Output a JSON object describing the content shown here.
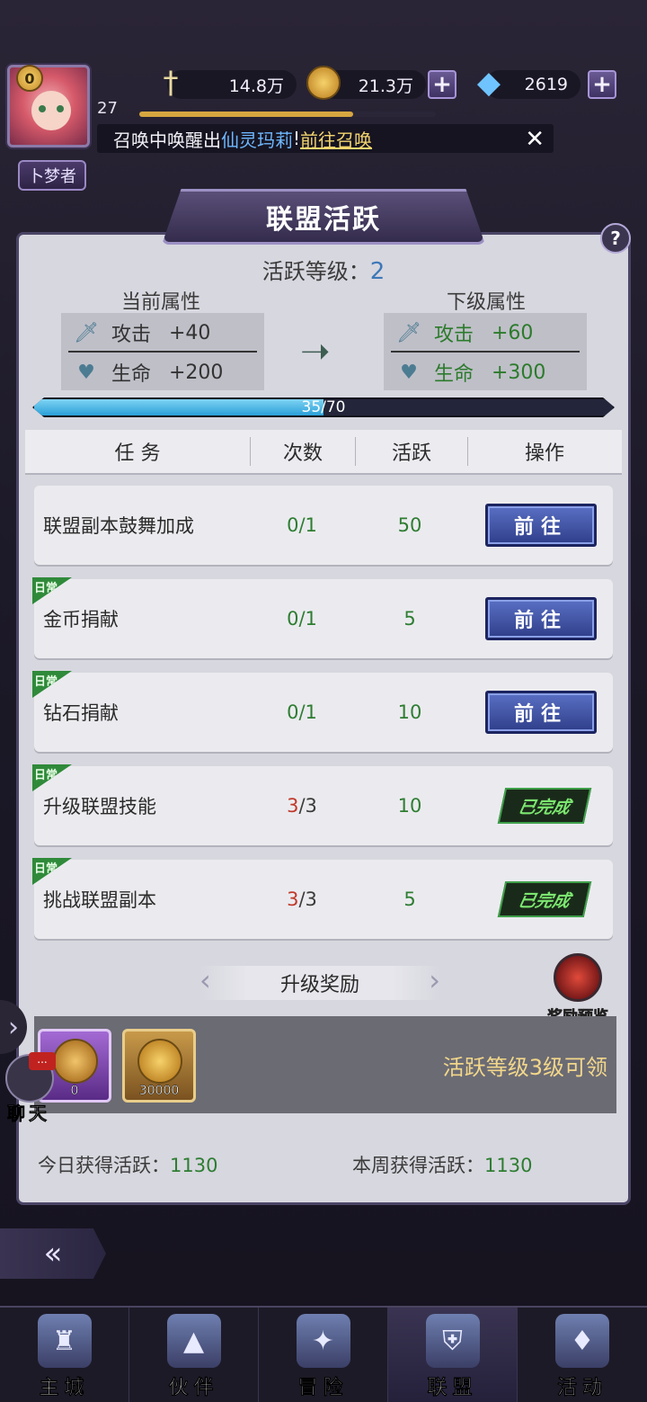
{
  "header": {
    "vip_level": "0",
    "player_level": "27",
    "title_tag": "卜梦者",
    "power": "14.8万",
    "gold": "21.3万",
    "diamonds": "2619",
    "xp_fraction": 0.72,
    "ticker_prefix": "召唤中唤醒出",
    "ticker_hero": "仙灵玛莉",
    "ticker_excl": "!",
    "ticker_link": "前往召唤"
  },
  "panel": {
    "title": "联盟活跃",
    "help": "?",
    "activity_level_label": "活跃等级：",
    "activity_level": "2",
    "current_attr_title": "当前属性",
    "next_attr_title": "下级属性",
    "current": [
      {
        "icon": "sword-icon",
        "label": "攻击",
        "value": "+40"
      },
      {
        "icon": "heart-icon",
        "label": "生命",
        "value": "+200"
      }
    ],
    "next": [
      {
        "icon": "sword-icon",
        "label": "攻击",
        "value": "+60"
      },
      {
        "icon": "heart-icon",
        "label": "生命",
        "value": "+300"
      }
    ],
    "progress_text": "35/70",
    "progress_value": 35,
    "progress_max": 70
  },
  "table": {
    "headers": [
      "任  务",
      "次数",
      "活跃",
      "操作"
    ],
    "rows": [
      {
        "name": "联盟副本鼓舞加成",
        "daily": false,
        "done": "0",
        "total": "/1",
        "points": "50",
        "action": "前往",
        "status": "go"
      },
      {
        "name": "金币捐献",
        "daily": true,
        "done": "0",
        "total": "/1",
        "points": "5",
        "action": "前往",
        "status": "go"
      },
      {
        "name": "钻石捐献",
        "daily": true,
        "done": "0",
        "total": "/1",
        "points": "10",
        "action": "前往",
        "status": "go"
      },
      {
        "name": "升级联盟技能",
        "daily": true,
        "done": "3",
        "total": "/3",
        "points": "10",
        "action": "已完成",
        "status": "done"
      },
      {
        "name": "挑战联盟副本",
        "daily": true,
        "done": "3",
        "total": "/3",
        "points": "5",
        "action": "已完成",
        "status": "done"
      }
    ],
    "daily_tag": "日常"
  },
  "reward": {
    "title": "升级奖励",
    "preview_label": "奖励预览",
    "item1_qty": "0",
    "item2_qty": "30000",
    "claim_text": "活跃等级3级可领"
  },
  "footer": {
    "today_label": "今日获得活跃：",
    "today_value": "1130",
    "week_label": "本周获得活跃：",
    "week_value": "1130"
  },
  "chat": {
    "label": "聊天",
    "bubble": "..."
  },
  "nav": [
    {
      "label": "主城",
      "icon": "castle-icon"
    },
    {
      "label": "伙伴",
      "icon": "hat-icon"
    },
    {
      "label": "冒险",
      "icon": "compass-icon"
    },
    {
      "label": "联盟",
      "icon": "shield-icon",
      "active": true
    },
    {
      "label": "活动",
      "icon": "cards-icon"
    }
  ]
}
